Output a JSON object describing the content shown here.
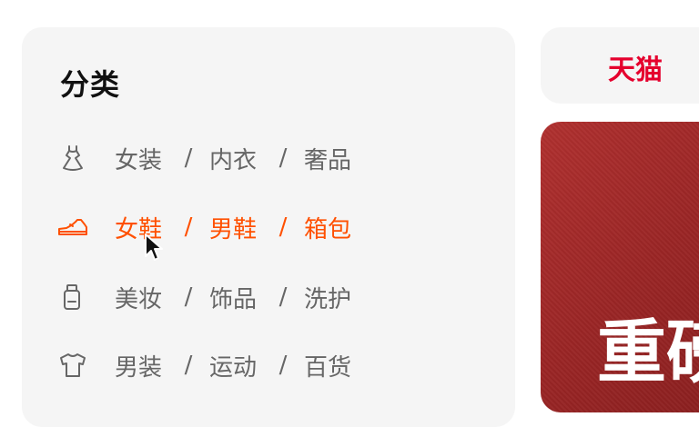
{
  "category": {
    "title": "分类",
    "separator": "/",
    "rows": [
      {
        "icon": "dress-icon",
        "links": [
          "女装",
          "内衣",
          "奢品"
        ],
        "active": false
      },
      {
        "icon": "shoe-icon",
        "links": [
          "女鞋",
          "男鞋",
          "箱包"
        ],
        "active": true
      },
      {
        "icon": "cosmetics-bottle-icon",
        "links": [
          "美妆",
          "饰品",
          "洗护"
        ],
        "active": false
      },
      {
        "icon": "tshirt-icon",
        "links": [
          "男装",
          "运动",
          "百货"
        ],
        "active": false
      }
    ]
  },
  "tmall": {
    "label": "天猫"
  },
  "banner": {
    "text": "重磅"
  },
  "colors": {
    "accent": "#ff5000",
    "tmall_red": "#e5002d",
    "banner_red": "#a12828",
    "panel_bg": "#f5f5f5"
  }
}
